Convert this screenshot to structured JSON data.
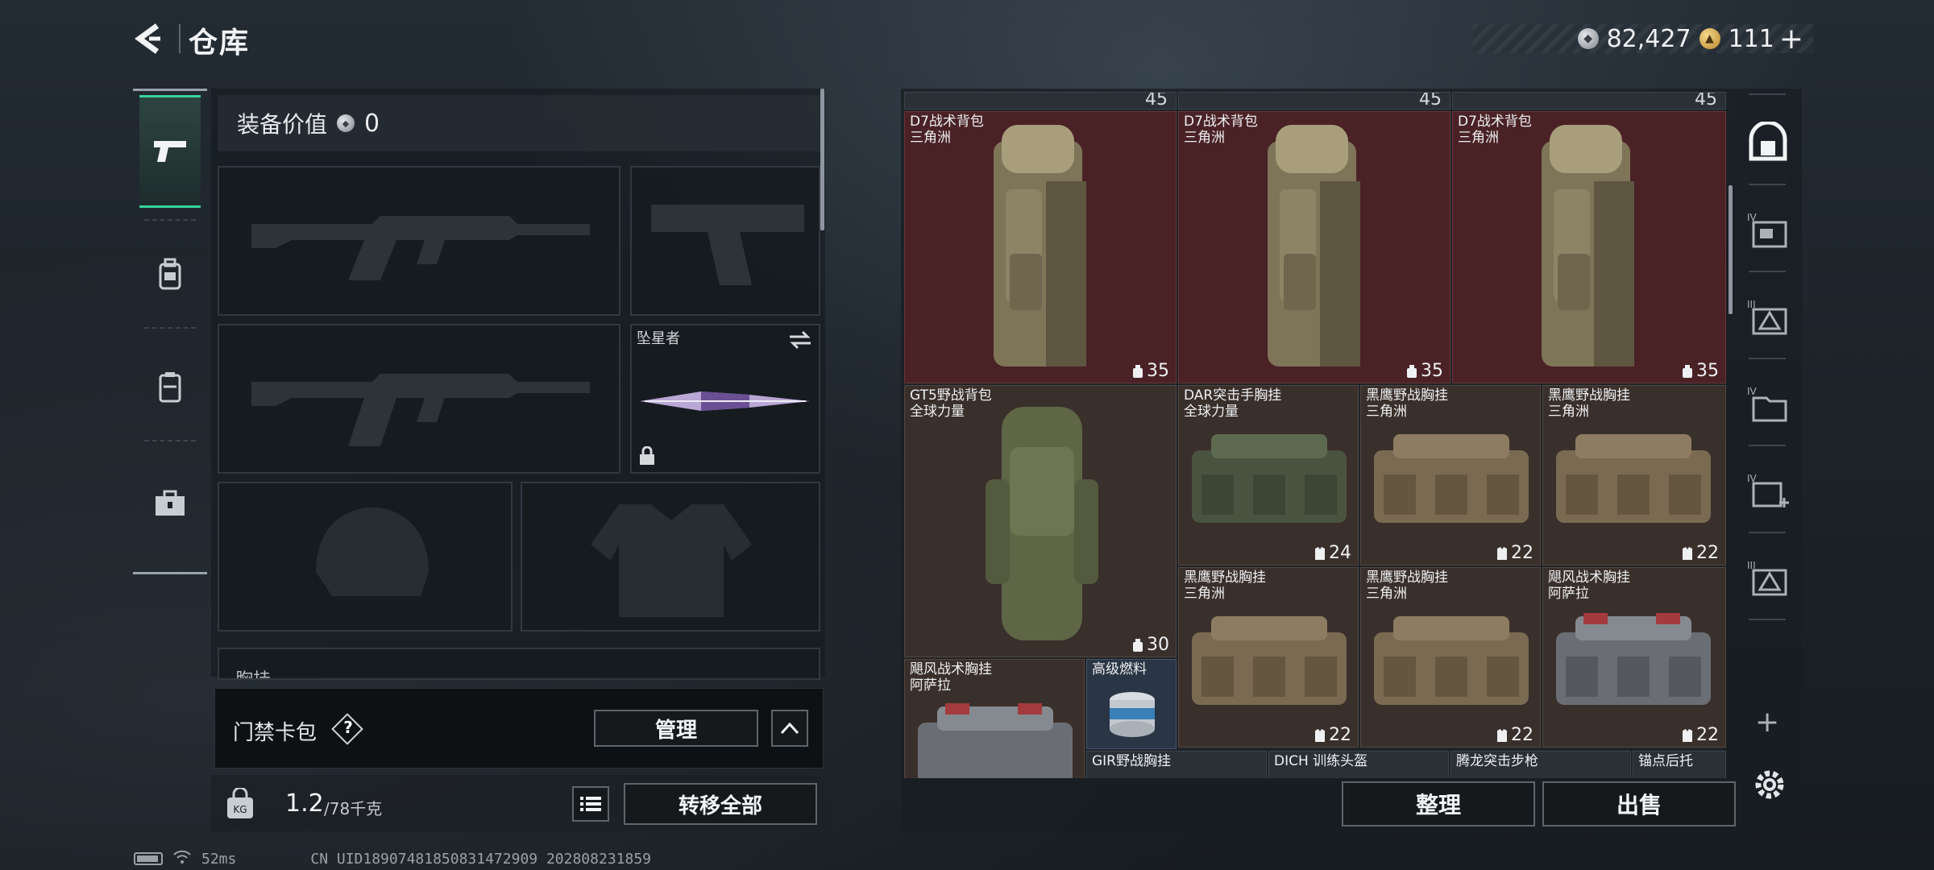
{
  "header": {
    "title": "仓库",
    "silver_balance": "82,427",
    "gold_balance": "111",
    "plus_label": "+"
  },
  "left_tabs": [
    {
      "id": "weapons",
      "icon": "pistol-icon",
      "active": true
    },
    {
      "id": "gear",
      "icon": "backpack-icon",
      "active": false
    },
    {
      "id": "vest",
      "icon": "vest-icon",
      "active": false
    },
    {
      "id": "kit",
      "icon": "toolbox-icon",
      "active": false
    }
  ],
  "loadout": {
    "equip_value_label": "装备价值",
    "equip_value": "0",
    "melee_slot_label": "坠星者",
    "chest_rig_partial_label": "胸挂"
  },
  "card_pack": {
    "title": "门禁卡包",
    "help_label": "?",
    "manage_label": "管理"
  },
  "weight": {
    "current": "1.2",
    "max": "/78千克",
    "transfer_label": "转移全部"
  },
  "status": {
    "ping": "52ms",
    "uid": "CN UID18907481850831472909 202808231859"
  },
  "warehouse": {
    "top_row_stats": [
      "45",
      "45",
      "45"
    ],
    "items": [
      {
        "name": "D7战术背包",
        "origin": "三角洲",
        "stat": "35",
        "stat_icon": "backpack-stat-icon"
      },
      {
        "name": "D7战术背包",
        "origin": "三角洲",
        "stat": "35",
        "stat_icon": "backpack-stat-icon"
      },
      {
        "name": "D7战术背包",
        "origin": "三角洲",
        "stat": "35",
        "stat_icon": "backpack-stat-icon"
      },
      {
        "name": "GT5野战背包",
        "origin": "全球力量",
        "stat": "30",
        "stat_icon": "backpack-stat-icon"
      },
      {
        "name": "DAR突击手胸挂",
        "origin": "全球力量",
        "stat": "24",
        "stat_icon": "vest-stat-icon"
      },
      {
        "name": "黑鹰野战胸挂",
        "origin": "三角洲",
        "stat": "22",
        "stat_icon": "vest-stat-icon"
      },
      {
        "name": "黑鹰野战胸挂",
        "origin": "三角洲",
        "stat": "22",
        "stat_icon": "vest-stat-icon"
      },
      {
        "name": "黑鹰野战胸挂",
        "origin": "三角洲",
        "stat": "22",
        "stat_icon": "vest-stat-icon"
      },
      {
        "name": "黑鹰野战胸挂",
        "origin": "三角洲",
        "stat": "22",
        "stat_icon": "vest-stat-icon"
      },
      {
        "name": "飓风战术胸挂",
        "origin": "阿萨拉",
        "stat": "22",
        "stat_icon": "vest-stat-icon"
      },
      {
        "name": "飓风战术胸挂",
        "origin": "阿萨拉",
        "stat": "",
        "stat_icon": ""
      },
      {
        "name": "高级燃料",
        "origin": "",
        "stat": "",
        "stat_icon": ""
      },
      {
        "name": "GIR野战胸挂",
        "origin": "",
        "stat": "",
        "stat_icon": ""
      },
      {
        "name": "DICH 训练头盔",
        "origin": "",
        "stat": "",
        "stat_icon": ""
      },
      {
        "name": "腾龙突击步枪",
        "origin": "",
        "stat": "",
        "stat_icon": ""
      },
      {
        "name": "锚点后托",
        "origin": "",
        "stat": "",
        "stat_icon": ""
      }
    ],
    "sort_label": "整理",
    "sell_label": "出售"
  },
  "right_tabs": [
    {
      "id": "all",
      "icon": "storage-all-icon",
      "active": true
    },
    {
      "id": "iv1",
      "icon": "storage-tab-iv-icon"
    },
    {
      "id": "iii1",
      "icon": "storage-tab-iii-icon"
    },
    {
      "id": "iv2",
      "icon": "storage-tab-iv-folder-icon"
    },
    {
      "id": "iv3",
      "icon": "storage-tab-iv-plus-icon"
    },
    {
      "id": "iii2",
      "icon": "storage-tab-iii-triangle-icon"
    }
  ],
  "colors": {
    "accent": "#37d39b",
    "rare_red": "#4a2226",
    "epic_brown": "#3a302b",
    "blue": "#2a3545"
  }
}
